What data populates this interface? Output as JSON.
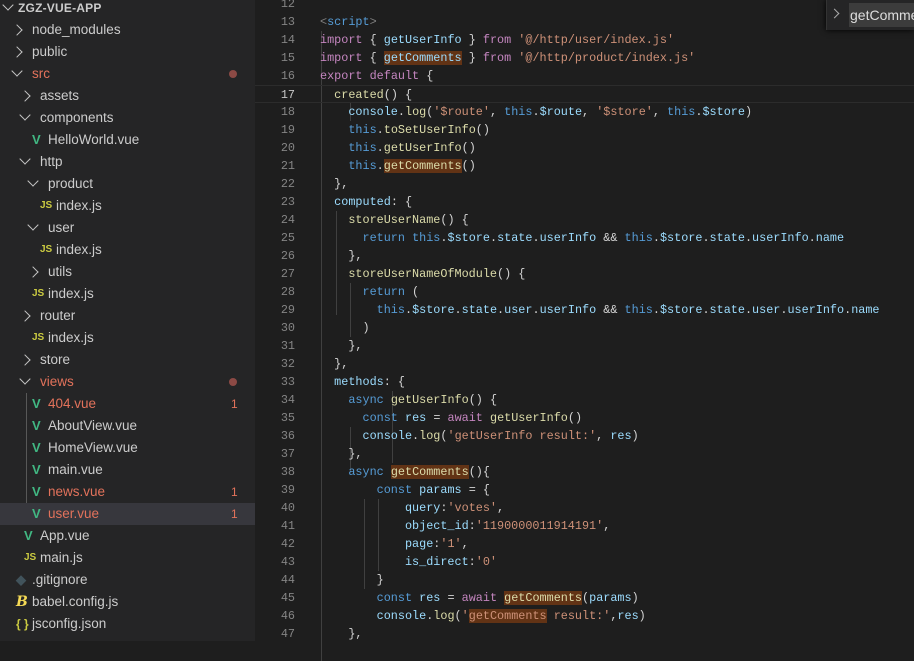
{
  "explorer": {
    "items": [
      {
        "label": "ZGZ-VUE-APP",
        "depth": 0,
        "type": "root",
        "chev": "open"
      },
      {
        "label": "node_modules",
        "depth": 1,
        "chev": "closed"
      },
      {
        "label": "public",
        "depth": 1,
        "chev": "closed"
      },
      {
        "label": "src",
        "depth": 1,
        "chev": "open",
        "git": true,
        "dot": true
      },
      {
        "label": "assets",
        "depth": 2,
        "chev": "closed"
      },
      {
        "label": "components",
        "depth": 2,
        "chev": "open"
      },
      {
        "label": "HelloWorld.vue",
        "depth": 3,
        "icon": "vue"
      },
      {
        "label": "http",
        "depth": 2,
        "chev": "open"
      },
      {
        "label": "product",
        "depth": 3,
        "chev": "open"
      },
      {
        "label": "index.js",
        "depth": 4,
        "icon": "js"
      },
      {
        "label": "user",
        "depth": 3,
        "chev": "open"
      },
      {
        "label": "index.js",
        "depth": 4,
        "icon": "js"
      },
      {
        "label": "utils",
        "depth": 3,
        "chev": "closed"
      },
      {
        "label": "index.js",
        "depth": 3,
        "icon": "js"
      },
      {
        "label": "router",
        "depth": 2,
        "chev": "closed"
      },
      {
        "label": "index.js",
        "depth": 3,
        "icon": "js"
      },
      {
        "label": "store",
        "depth": 2,
        "chev": "closed"
      },
      {
        "label": "views",
        "depth": 2,
        "chev": "open",
        "git": true,
        "dot": true
      },
      {
        "label": "404.vue",
        "depth": 3,
        "icon": "vue",
        "git": true,
        "badge": "1"
      },
      {
        "label": "AboutView.vue",
        "depth": 3,
        "icon": "vue"
      },
      {
        "label": "HomeView.vue",
        "depth": 3,
        "icon": "vue"
      },
      {
        "label": "main.vue",
        "depth": 3,
        "icon": "vue"
      },
      {
        "label": "news.vue",
        "depth": 3,
        "icon": "vue",
        "git": true,
        "badge": "1"
      },
      {
        "label": "user.vue",
        "depth": 3,
        "icon": "vue",
        "git": true,
        "badge": "1",
        "selected": true
      },
      {
        "label": "App.vue",
        "depth": 2,
        "icon": "vue"
      },
      {
        "label": "main.js",
        "depth": 2,
        "icon": "js"
      },
      {
        "label": ".gitignore",
        "depth": 1,
        "icon": "git"
      },
      {
        "label": "babel.config.js",
        "depth": 1,
        "icon": "babel"
      },
      {
        "label": "jsconfig.json",
        "depth": 1,
        "icon": "json"
      }
    ]
  },
  "icons": {
    "vue": "V",
    "js": "JS",
    "git": "◆",
    "babel": "B",
    "json": "{ }"
  },
  "breadcrumb": {
    "symbol": "getComments"
  },
  "editor": {
    "current_line": 17,
    "lines": [
      {
        "n": "12",
        "t": []
      },
      {
        "n": "13",
        "t": [
          [
            "t",
            "<"
          ],
          [
            "b",
            "script"
          ],
          [
            "t",
            ">"
          ]
        ]
      },
      {
        "n": "14",
        "t": [
          [
            "k",
            "import"
          ],
          [
            "p",
            " { "
          ],
          [
            "v",
            "getUserInfo"
          ],
          [
            "p",
            " } "
          ],
          [
            "k",
            "from"
          ],
          [
            "p",
            " "
          ],
          [
            "s",
            "'@/http/user/index.js'"
          ]
        ]
      },
      {
        "n": "15",
        "t": [
          [
            "k",
            "import"
          ],
          [
            "p",
            " { "
          ],
          [
            "v h",
            "getComments"
          ],
          [
            "p",
            " } "
          ],
          [
            "k",
            "from"
          ],
          [
            "p",
            " "
          ],
          [
            "s",
            "'@/http/product/index.js'"
          ]
        ]
      },
      {
        "n": "16",
        "t": [
          [
            "k",
            "export"
          ],
          [
            "p",
            " "
          ],
          [
            "k",
            "default"
          ],
          [
            "p",
            " {"
          ]
        ]
      },
      {
        "n": "17",
        "t": [
          [
            "p",
            "  "
          ],
          [
            "f",
            "created"
          ],
          [
            "p",
            "() {"
          ]
        ]
      },
      {
        "n": "18",
        "t": [
          [
            "p",
            "    "
          ],
          [
            "v",
            "console"
          ],
          [
            "p",
            "."
          ],
          [
            "f",
            "log"
          ],
          [
            "p",
            "("
          ],
          [
            "s",
            "'$route'"
          ],
          [
            "p",
            ", "
          ],
          [
            "b",
            "this"
          ],
          [
            "p",
            "."
          ],
          [
            "v",
            "$route"
          ],
          [
            "p",
            ", "
          ],
          [
            "s",
            "'$store'"
          ],
          [
            "p",
            ", "
          ],
          [
            "b",
            "this"
          ],
          [
            "p",
            "."
          ],
          [
            "v",
            "$store"
          ],
          [
            "p",
            ")"
          ]
        ]
      },
      {
        "n": "19",
        "t": [
          [
            "p",
            "    "
          ],
          [
            "b",
            "this"
          ],
          [
            "p",
            "."
          ],
          [
            "f",
            "toSetUserInfo"
          ],
          [
            "p",
            "()"
          ]
        ]
      },
      {
        "n": "20",
        "t": [
          [
            "p",
            "    "
          ],
          [
            "b",
            "this"
          ],
          [
            "p",
            "."
          ],
          [
            "f",
            "getUserInfo"
          ],
          [
            "p",
            "()"
          ]
        ]
      },
      {
        "n": "21",
        "t": [
          [
            "p",
            "    "
          ],
          [
            "b",
            "this"
          ],
          [
            "p",
            "."
          ],
          [
            "f h",
            "getComments"
          ],
          [
            "p",
            "()"
          ]
        ]
      },
      {
        "n": "22",
        "t": [
          [
            "p",
            "  },"
          ]
        ]
      },
      {
        "n": "23",
        "t": [
          [
            "p",
            "  "
          ],
          [
            "v",
            "computed"
          ],
          [
            "p",
            ": {"
          ]
        ]
      },
      {
        "n": "24",
        "t": [
          [
            "p",
            "    "
          ],
          [
            "f",
            "storeUserName"
          ],
          [
            "p",
            "() {"
          ]
        ]
      },
      {
        "n": "25",
        "t": [
          [
            "p",
            "      "
          ],
          [
            "b",
            "return"
          ],
          [
            "p",
            " "
          ],
          [
            "b",
            "this"
          ],
          [
            "p",
            "."
          ],
          [
            "v",
            "$store"
          ],
          [
            "p",
            "."
          ],
          [
            "v",
            "state"
          ],
          [
            "p",
            "."
          ],
          [
            "v",
            "userInfo"
          ],
          [
            "p",
            " && "
          ],
          [
            "b",
            "this"
          ],
          [
            "p",
            "."
          ],
          [
            "v",
            "$store"
          ],
          [
            "p",
            "."
          ],
          [
            "v",
            "state"
          ],
          [
            "p",
            "."
          ],
          [
            "v",
            "userInfo"
          ],
          [
            "p",
            "."
          ],
          [
            "v",
            "name"
          ]
        ]
      },
      {
        "n": "26",
        "t": [
          [
            "p",
            "    },"
          ]
        ]
      },
      {
        "n": "27",
        "t": [
          [
            "p",
            "    "
          ],
          [
            "f",
            "storeUserNameOfModule"
          ],
          [
            "p",
            "() {"
          ]
        ]
      },
      {
        "n": "28",
        "t": [
          [
            "p",
            "      "
          ],
          [
            "b",
            "return"
          ],
          [
            "p",
            " ("
          ]
        ]
      },
      {
        "n": "29",
        "t": [
          [
            "p",
            "        "
          ],
          [
            "b",
            "this"
          ],
          [
            "p",
            "."
          ],
          [
            "v",
            "$store"
          ],
          [
            "p",
            "."
          ],
          [
            "v",
            "state"
          ],
          [
            "p",
            "."
          ],
          [
            "v",
            "user"
          ],
          [
            "p",
            "."
          ],
          [
            "v",
            "userInfo"
          ],
          [
            "p",
            " && "
          ],
          [
            "b",
            "this"
          ],
          [
            "p",
            "."
          ],
          [
            "v",
            "$store"
          ],
          [
            "p",
            "."
          ],
          [
            "v",
            "state"
          ],
          [
            "p",
            "."
          ],
          [
            "v",
            "user"
          ],
          [
            "p",
            "."
          ],
          [
            "v",
            "userInfo"
          ],
          [
            "p",
            "."
          ],
          [
            "v",
            "name"
          ]
        ]
      },
      {
        "n": "30",
        "t": [
          [
            "p",
            "      )"
          ]
        ]
      },
      {
        "n": "31",
        "t": [
          [
            "p",
            "    },"
          ]
        ]
      },
      {
        "n": "32",
        "t": [
          [
            "p",
            "  },"
          ]
        ]
      },
      {
        "n": "33",
        "t": [
          [
            "p",
            "  "
          ],
          [
            "v",
            "methods"
          ],
          [
            "p",
            ": {"
          ]
        ]
      },
      {
        "n": "34",
        "t": [
          [
            "p",
            "    "
          ],
          [
            "b",
            "async"
          ],
          [
            "p",
            " "
          ],
          [
            "f",
            "getUserInfo"
          ],
          [
            "p",
            "() {"
          ]
        ]
      },
      {
        "n": "35",
        "t": [
          [
            "p",
            "      "
          ],
          [
            "b",
            "const"
          ],
          [
            "p",
            " "
          ],
          [
            "v",
            "res"
          ],
          [
            "p",
            " = "
          ],
          [
            "k",
            "await"
          ],
          [
            "p",
            " "
          ],
          [
            "f",
            "getUserInfo"
          ],
          [
            "p",
            "()"
          ]
        ]
      },
      {
        "n": "36",
        "t": [
          [
            "p",
            "      "
          ],
          [
            "v",
            "console"
          ],
          [
            "p",
            "."
          ],
          [
            "f",
            "log"
          ],
          [
            "p",
            "("
          ],
          [
            "s",
            "'getUserInfo result:'"
          ],
          [
            "p",
            ", "
          ],
          [
            "v",
            "res"
          ],
          [
            "p",
            ")"
          ]
        ]
      },
      {
        "n": "37",
        "t": [
          [
            "p",
            "    },"
          ]
        ]
      },
      {
        "n": "38",
        "t": [
          [
            "p",
            "    "
          ],
          [
            "b",
            "async"
          ],
          [
            "p",
            " "
          ],
          [
            "f h",
            "getComments"
          ],
          [
            "p",
            "(){"
          ]
        ]
      },
      {
        "n": "39",
        "t": [
          [
            "p",
            "        "
          ],
          [
            "b",
            "const"
          ],
          [
            "p",
            " "
          ],
          [
            "v",
            "params"
          ],
          [
            "p",
            " = {"
          ]
        ]
      },
      {
        "n": "40",
        "t": [
          [
            "p",
            "            "
          ],
          [
            "v",
            "query"
          ],
          [
            "p",
            ":"
          ],
          [
            "s",
            "'votes'"
          ],
          [
            "p",
            ","
          ]
        ]
      },
      {
        "n": "41",
        "t": [
          [
            "p",
            "            "
          ],
          [
            "v",
            "object_id"
          ],
          [
            "p",
            ":"
          ],
          [
            "s",
            "'1190000011914191'"
          ],
          [
            "p",
            ","
          ]
        ]
      },
      {
        "n": "42",
        "t": [
          [
            "p",
            "            "
          ],
          [
            "v",
            "page"
          ],
          [
            "p",
            ":"
          ],
          [
            "s",
            "'1'"
          ],
          [
            "p",
            ","
          ]
        ]
      },
      {
        "n": "43",
        "t": [
          [
            "p",
            "            "
          ],
          [
            "v",
            "is_direct"
          ],
          [
            "p",
            ":"
          ],
          [
            "s",
            "'0'"
          ]
        ]
      },
      {
        "n": "44",
        "t": [
          [
            "p",
            "        }"
          ]
        ]
      },
      {
        "n": "45",
        "t": [
          [
            "p",
            "        "
          ],
          [
            "b",
            "const"
          ],
          [
            "p",
            " "
          ],
          [
            "v",
            "res"
          ],
          [
            "p",
            " = "
          ],
          [
            "k",
            "await"
          ],
          [
            "p",
            " "
          ],
          [
            "f h",
            "getComments"
          ],
          [
            "p",
            "("
          ],
          [
            "v",
            "params"
          ],
          [
            "p",
            ")"
          ]
        ]
      },
      {
        "n": "46",
        "t": [
          [
            "p",
            "        "
          ],
          [
            "v",
            "console"
          ],
          [
            "p",
            "."
          ],
          [
            "f",
            "log"
          ],
          [
            "p",
            "("
          ],
          [
            "s",
            "'"
          ],
          [
            "s h",
            "getComments"
          ],
          [
            "s",
            " result:'"
          ],
          [
            "p",
            ","
          ],
          [
            "v",
            "res"
          ],
          [
            "p",
            ")"
          ]
        ]
      },
      {
        "n": "47",
        "t": [
          [
            "p",
            "    },"
          ]
        ]
      }
    ]
  }
}
